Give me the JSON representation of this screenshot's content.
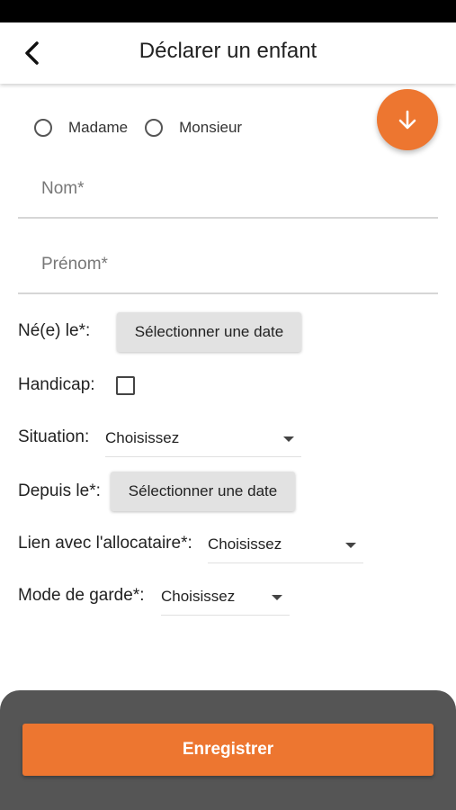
{
  "header": {
    "title": "Déclarer un enfant"
  },
  "icons": {
    "back": "chevron-left-icon",
    "fab": "arrow-down-icon"
  },
  "colors": {
    "accent": "#ed7630",
    "bottom_sheet": "#555555",
    "status_bar": "#000000"
  },
  "civility": {
    "options": [
      "Madame",
      "Monsieur"
    ]
  },
  "fields": {
    "nom": {
      "placeholder": "Nom*",
      "value": ""
    },
    "prenom": {
      "placeholder": "Prénom*",
      "value": ""
    }
  },
  "birth": {
    "label": "Né(e) le*:",
    "button": "Sélectionner une date"
  },
  "handicap": {
    "label": "Handicap:",
    "checked": false
  },
  "situation": {
    "label": "Situation:",
    "value": "Choisissez"
  },
  "since": {
    "label": "Depuis le*:",
    "button": "Sélectionner une date"
  },
  "lien": {
    "label": "Lien avec l'allocataire*:",
    "value": "Choisissez"
  },
  "garde": {
    "label": "Mode de garde*:",
    "value": "Choisissez"
  },
  "actions": {
    "save": "Enregistrer"
  }
}
